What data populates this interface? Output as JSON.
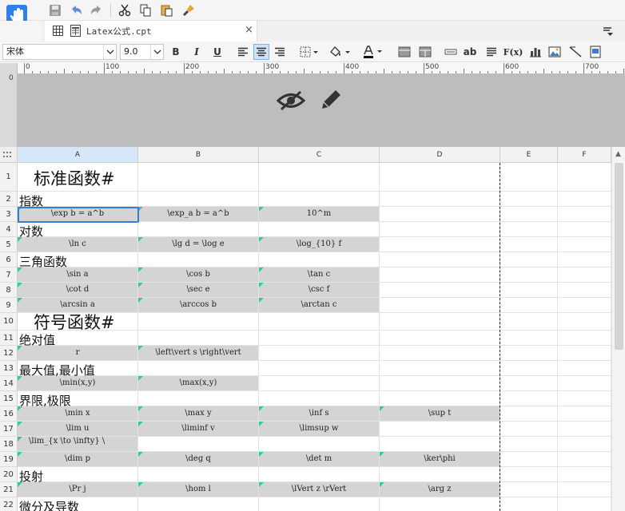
{
  "tab": {
    "title": "Latex公式.cpt",
    "close": "×"
  },
  "format": {
    "font_name": "宋体",
    "font_size": "9.0",
    "bold": "B",
    "italic": "I",
    "underline": "U",
    "text_icon": "ab",
    "formula_icon": "F(x)"
  },
  "ruler": {
    "marks": [
      "0",
      "100",
      "200",
      "300",
      "400",
      "500",
      "600",
      "700"
    ],
    "vertical_mark": "0"
  },
  "columns": [
    "A",
    "B",
    "C",
    "D",
    "E",
    "F"
  ],
  "rows": [
    {
      "n": "1",
      "type": "title",
      "text": "标准函数#"
    },
    {
      "n": "2",
      "type": "section",
      "text": "指数"
    },
    {
      "n": "3",
      "type": "data",
      "cells": [
        "\\exp b = a^b",
        "\\exp_a b = a^b",
        "10^m",
        ""
      ]
    },
    {
      "n": "4",
      "type": "section",
      "text": "对数"
    },
    {
      "n": "5",
      "type": "data",
      "cells": [
        "\\ln c",
        "\\lg d = \\log e",
        "\\log_{10} f",
        ""
      ]
    },
    {
      "n": "6",
      "type": "section",
      "text": "三角函数"
    },
    {
      "n": "7",
      "type": "data",
      "cells": [
        "\\sin a",
        "\\cos b",
        "\\tan c",
        ""
      ]
    },
    {
      "n": "8",
      "type": "data",
      "cells": [
        "\\cot d",
        "\\sec e",
        "\\csc f",
        ""
      ]
    },
    {
      "n": "9",
      "type": "data",
      "cells": [
        "\\arcsin a",
        "\\arccos b",
        "\\arctan c",
        ""
      ]
    },
    {
      "n": "10",
      "type": "title",
      "text": "符号函数#"
    },
    {
      "n": "11",
      "type": "section",
      "text": "绝对值"
    },
    {
      "n": "12",
      "type": "data",
      "cells": [
        "r",
        "\\left\\vert s \\right\\vert",
        "",
        ""
      ]
    },
    {
      "n": "13",
      "type": "section",
      "text": "最大值,最小值"
    },
    {
      "n": "14",
      "type": "data",
      "cells": [
        "\\min(x,y)",
        "\\max(x,y)",
        "",
        ""
      ]
    },
    {
      "n": "15",
      "type": "section",
      "text": "界限,极限"
    },
    {
      "n": "16",
      "type": "data",
      "cells": [
        "\\min x",
        "\\max y",
        "\\inf s",
        "\\sup t"
      ]
    },
    {
      "n": "17",
      "type": "data",
      "cells": [
        "\\lim u",
        "\\liminf v",
        "\\limsup w",
        ""
      ]
    },
    {
      "n": "18",
      "type": "data-left",
      "cells": [
        "\\lim_{x \\to \\infty} \\",
        "",
        "",
        ""
      ]
    },
    {
      "n": "19",
      "type": "data",
      "cells": [
        "\\dim p",
        "\\deg q",
        "\\det m",
        "\\ker\\phi"
      ]
    },
    {
      "n": "20",
      "type": "section",
      "text": "投射"
    },
    {
      "n": "21",
      "type": "data",
      "cells": [
        "\\Pr j",
        "\\hom l",
        "\\lVert z \\rVert",
        "\\arg z"
      ]
    },
    {
      "n": "22",
      "type": "section",
      "text": "微分及导数"
    }
  ]
}
